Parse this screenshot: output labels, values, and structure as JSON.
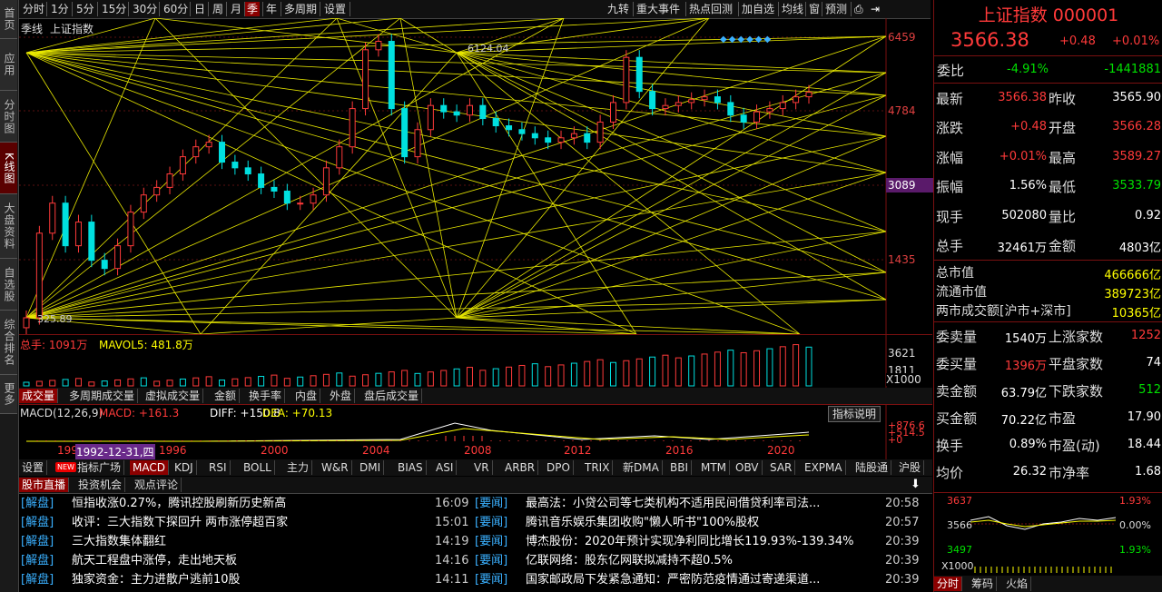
{
  "left_nav": [
    "首页",
    "应用",
    "分时图",
    "K线图",
    "大盘资料",
    "自选股",
    "综合排名",
    "更多"
  ],
  "toolbar": {
    "periods": [
      "分时",
      "1分",
      "5分",
      "15分",
      "30分",
      "60分",
      "日",
      "周",
      "月",
      "季",
      "年",
      "多周期",
      "设置"
    ],
    "selected_period": "季",
    "right_tools": [
      "九转",
      "重大事件",
      "热点回测",
      "加自选",
      "均线",
      "窗",
      "预测"
    ]
  },
  "chart": {
    "label_period": "季线",
    "label_name": "上证指数",
    "high_label": "6124.04",
    "low_label": "325.89",
    "price_axis": [
      "6459",
      "4784",
      "3089",
      "1435"
    ],
    "current_price_tag": "3089",
    "volume_axis": [
      "3621",
      "1811",
      "X1000"
    ],
    "volume_legend": "总手: 1091万",
    "mavol_legend": "MAVOL5: 481.8万",
    "macd_legend": [
      "MACD(12,26,9)",
      "MACD: +161.3",
      "DIFF: +150.8",
      "DEA: +70.13"
    ],
    "macd_axis": [
      "+876.6",
      "+514.5",
      "+0"
    ],
    "macd_button": "指标说明",
    "x_labels": [
      "1996",
      "2000",
      "2004",
      "2008",
      "2012",
      "2016",
      "2020"
    ],
    "x_first": "199",
    "cursor_date": "1992-12-31,四",
    "volume_tabs": [
      "成交量",
      "多周期成交量",
      "虚拟成交量",
      "金额",
      "换手率",
      "内盘",
      "外盘",
      "盘后成交量"
    ],
    "indicator_tabs": [
      "设置",
      "指标广场",
      "MACD",
      "KDJ",
      "RSI",
      "BOLL",
      "主力",
      "W&R",
      "DMI",
      "BIAS",
      "ASI",
      "VR",
      "ARBR",
      "DPO",
      "TRIX",
      "新DMA",
      "BBI",
      "MTM",
      "OBV",
      "SAR",
      "EXPMA",
      "陆股通",
      "沪股"
    ],
    "new_badge": "NEW"
  },
  "chart_data": {
    "type": "candlestick",
    "title": "上证指数 季线",
    "x_range": [
      "1990",
      "2021"
    ],
    "ylim": [
      325.89,
      6459
    ],
    "series": [
      {
        "name": "季线",
        "values": [
          325.89,
          800,
          1100,
          700,
          900,
          600,
          550,
          700,
          1000,
          1200,
          1300,
          1500,
          1800,
          2000,
          2100,
          1700,
          1600,
          1500,
          1300,
          1250,
          1100,
          1100,
          1200,
          1600,
          2000,
          3000,
          5600,
          6124.04,
          3000,
          1800,
          2400,
          3100,
          2900,
          2800,
          3100,
          2700,
          2500,
          2400,
          2300,
          2200,
          2100,
          2200,
          2300,
          2100,
          2600,
          3200,
          5166,
          3600,
          3000,
          3100,
          3200,
          3300,
          3400,
          3200,
          2800,
          2600,
          2900,
          3000,
          3200,
          3400,
          3566.38
        ]
      }
    ]
  },
  "right_panel": {
    "title": "上证指数 000001",
    "price": "3566.38",
    "change": "+0.48",
    "change_pct": "+0.01%",
    "webi_label": "委比",
    "webi_pct": "-4.91%",
    "webi_val": "-1441881",
    "rows": [
      {
        "l1": "最新",
        "v1": "3566.38",
        "c1": "red",
        "l2": "昨收",
        "v2": "3565.90",
        "c2": "white"
      },
      {
        "l1": "涨跌",
        "v1": "+0.48",
        "c1": "red",
        "l2": "开盘",
        "v2": "3566.28",
        "c2": "red"
      },
      {
        "l1": "涨幅",
        "v1": "+0.01%",
        "c1": "red",
        "l2": "最高",
        "v2": "3589.27",
        "c2": "red"
      },
      {
        "l1": "振幅",
        "v1": "1.56%",
        "c1": "white",
        "l2": "最低",
        "v2": "3533.79",
        "c2": "green"
      },
      {
        "l1": "现手",
        "v1": "502080",
        "c1": "white",
        "l2": "量比",
        "v2": "0.92",
        "c2": "white"
      },
      {
        "l1": "总手",
        "v1": "32461万",
        "c1": "white",
        "l2": "金额",
        "v2": "4803亿",
        "c2": "white"
      }
    ],
    "market": [
      {
        "l": "总市值",
        "v": "466666亿"
      },
      {
        "l": "流通市值",
        "v": "389723亿"
      },
      {
        "l": "两市成交额[沪市+深市]",
        "v": "10365亿"
      }
    ],
    "rows2": [
      {
        "l1": "委卖量",
        "v1": "1540万",
        "c1": "white",
        "l2": "上涨家数",
        "v2": "1252",
        "c2": "red"
      },
      {
        "l1": "委买量",
        "v1": "1396万",
        "c1": "red",
        "l2": "平盘家数",
        "v2": "74",
        "c2": "white"
      },
      {
        "l1": "卖金额",
        "v1": "63.79亿",
        "c1": "white",
        "l2": "下跌家数",
        "v2": "512",
        "c2": "green"
      },
      {
        "l1": "买金额",
        "v1": "70.22亿",
        "c1": "white",
        "l2": "市盈",
        "v2": "17.90",
        "c2": "white"
      },
      {
        "l1": "换手",
        "v1": "0.89%",
        "c1": "white",
        "l2": "市盈(动)",
        "v2": "18.44",
        "c2": "white"
      },
      {
        "l1": "均价",
        "v1": "26.32",
        "c1": "white",
        "l2": "市净率",
        "v2": "1.68",
        "c2": "white"
      }
    ],
    "mini": {
      "top_left": "3637",
      "mid_left": "3566",
      "bot_left": "3497",
      "top_right": "1.93%",
      "mid_right": "0.00%",
      "bot_right": "1.93%",
      "scale": "X1000",
      "tabs": [
        "分时",
        "筹码",
        "火焰"
      ]
    }
  },
  "news": {
    "tabs": [
      "股市直播",
      "投资机会",
      "观点评论"
    ],
    "left": [
      {
        "tag": "[解盘]",
        "text": "恒指收涨0.27%，腾讯控股刷新历史新高",
        "time": "16:09"
      },
      {
        "tag": "[解盘]",
        "text": "收评：三大指数下探回升 两市涨停超百家",
        "time": "15:01"
      },
      {
        "tag": "[解盘]",
        "text": "三大指数集体翻红",
        "time": "14:19"
      },
      {
        "tag": "[解盘]",
        "text": "航天工程盘中涨停，走出地天板",
        "time": "14:16"
      },
      {
        "tag": "[解盘]",
        "text": "独家资金：主力进散户逃前10股",
        "time": "14:11"
      }
    ],
    "right": [
      {
        "tag": "[要闻]",
        "text": "最高法：小贷公司等七类机构不适用民间借贷利率司法...",
        "time": "20:58"
      },
      {
        "tag": "[要闻]",
        "text": "腾讯音乐娱乐集团收购\"懒人听书\"100%股权",
        "time": "20:57"
      },
      {
        "tag": "[要闻]",
        "text": "博杰股份：2020年预计实现净利同比增长119.93%-139.34%",
        "time": "20:39"
      },
      {
        "tag": "[要闻]",
        "text": "亿联网络：股东亿网联拟减持不超0.5%",
        "time": "20:39"
      },
      {
        "tag": "[要闻]",
        "text": "国家邮政局下发紧急通知：严密防范疫情通过寄递渠道...",
        "time": "20:39"
      }
    ]
  }
}
